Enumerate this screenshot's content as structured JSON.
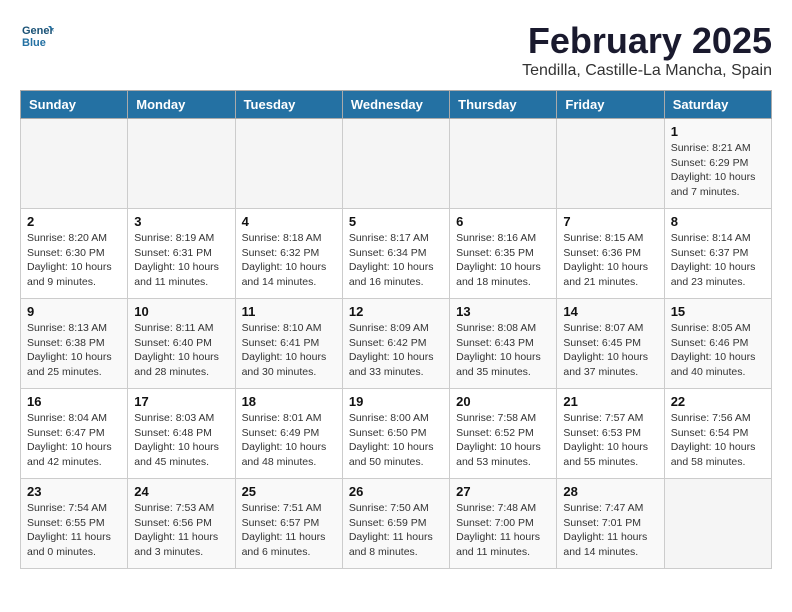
{
  "header": {
    "logo_line1": "General",
    "logo_line2": "Blue",
    "month": "February 2025",
    "location": "Tendilla, Castille-La Mancha, Spain"
  },
  "weekdays": [
    "Sunday",
    "Monday",
    "Tuesday",
    "Wednesday",
    "Thursday",
    "Friday",
    "Saturday"
  ],
  "weeks": [
    [
      {
        "day": "",
        "info": ""
      },
      {
        "day": "",
        "info": ""
      },
      {
        "day": "",
        "info": ""
      },
      {
        "day": "",
        "info": ""
      },
      {
        "day": "",
        "info": ""
      },
      {
        "day": "",
        "info": ""
      },
      {
        "day": "1",
        "info": "Sunrise: 8:21 AM\nSunset: 6:29 PM\nDaylight: 10 hours\nand 7 minutes."
      }
    ],
    [
      {
        "day": "2",
        "info": "Sunrise: 8:20 AM\nSunset: 6:30 PM\nDaylight: 10 hours\nand 9 minutes."
      },
      {
        "day": "3",
        "info": "Sunrise: 8:19 AM\nSunset: 6:31 PM\nDaylight: 10 hours\nand 11 minutes."
      },
      {
        "day": "4",
        "info": "Sunrise: 8:18 AM\nSunset: 6:32 PM\nDaylight: 10 hours\nand 14 minutes."
      },
      {
        "day": "5",
        "info": "Sunrise: 8:17 AM\nSunset: 6:34 PM\nDaylight: 10 hours\nand 16 minutes."
      },
      {
        "day": "6",
        "info": "Sunrise: 8:16 AM\nSunset: 6:35 PM\nDaylight: 10 hours\nand 18 minutes."
      },
      {
        "day": "7",
        "info": "Sunrise: 8:15 AM\nSunset: 6:36 PM\nDaylight: 10 hours\nand 21 minutes."
      },
      {
        "day": "8",
        "info": "Sunrise: 8:14 AM\nSunset: 6:37 PM\nDaylight: 10 hours\nand 23 minutes."
      }
    ],
    [
      {
        "day": "9",
        "info": "Sunrise: 8:13 AM\nSunset: 6:38 PM\nDaylight: 10 hours\nand 25 minutes."
      },
      {
        "day": "10",
        "info": "Sunrise: 8:11 AM\nSunset: 6:40 PM\nDaylight: 10 hours\nand 28 minutes."
      },
      {
        "day": "11",
        "info": "Sunrise: 8:10 AM\nSunset: 6:41 PM\nDaylight: 10 hours\nand 30 minutes."
      },
      {
        "day": "12",
        "info": "Sunrise: 8:09 AM\nSunset: 6:42 PM\nDaylight: 10 hours\nand 33 minutes."
      },
      {
        "day": "13",
        "info": "Sunrise: 8:08 AM\nSunset: 6:43 PM\nDaylight: 10 hours\nand 35 minutes."
      },
      {
        "day": "14",
        "info": "Sunrise: 8:07 AM\nSunset: 6:45 PM\nDaylight: 10 hours\nand 37 minutes."
      },
      {
        "day": "15",
        "info": "Sunrise: 8:05 AM\nSunset: 6:46 PM\nDaylight: 10 hours\nand 40 minutes."
      }
    ],
    [
      {
        "day": "16",
        "info": "Sunrise: 8:04 AM\nSunset: 6:47 PM\nDaylight: 10 hours\nand 42 minutes."
      },
      {
        "day": "17",
        "info": "Sunrise: 8:03 AM\nSunset: 6:48 PM\nDaylight: 10 hours\nand 45 minutes."
      },
      {
        "day": "18",
        "info": "Sunrise: 8:01 AM\nSunset: 6:49 PM\nDaylight: 10 hours\nand 48 minutes."
      },
      {
        "day": "19",
        "info": "Sunrise: 8:00 AM\nSunset: 6:50 PM\nDaylight: 10 hours\nand 50 minutes."
      },
      {
        "day": "20",
        "info": "Sunrise: 7:58 AM\nSunset: 6:52 PM\nDaylight: 10 hours\nand 53 minutes."
      },
      {
        "day": "21",
        "info": "Sunrise: 7:57 AM\nSunset: 6:53 PM\nDaylight: 10 hours\nand 55 minutes."
      },
      {
        "day": "22",
        "info": "Sunrise: 7:56 AM\nSunset: 6:54 PM\nDaylight: 10 hours\nand 58 minutes."
      }
    ],
    [
      {
        "day": "23",
        "info": "Sunrise: 7:54 AM\nSunset: 6:55 PM\nDaylight: 11 hours\nand 0 minutes."
      },
      {
        "day": "24",
        "info": "Sunrise: 7:53 AM\nSunset: 6:56 PM\nDaylight: 11 hours\nand 3 minutes."
      },
      {
        "day": "25",
        "info": "Sunrise: 7:51 AM\nSunset: 6:57 PM\nDaylight: 11 hours\nand 6 minutes."
      },
      {
        "day": "26",
        "info": "Sunrise: 7:50 AM\nSunset: 6:59 PM\nDaylight: 11 hours\nand 8 minutes."
      },
      {
        "day": "27",
        "info": "Sunrise: 7:48 AM\nSunset: 7:00 PM\nDaylight: 11 hours\nand 11 minutes."
      },
      {
        "day": "28",
        "info": "Sunrise: 7:47 AM\nSunset: 7:01 PM\nDaylight: 11 hours\nand 14 minutes."
      },
      {
        "day": "",
        "info": ""
      }
    ]
  ]
}
